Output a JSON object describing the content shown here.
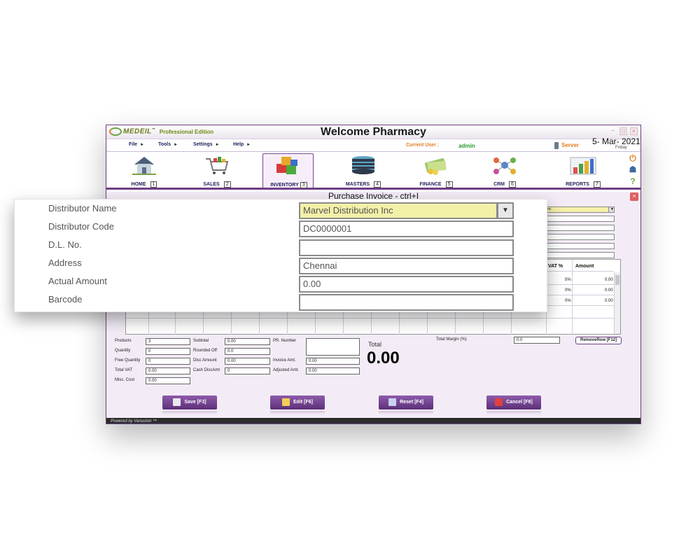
{
  "window": {
    "logo": "MEDEIL",
    "logo_tm": "™",
    "edition": "Professional Edition",
    "title": "Welcome Pharmacy",
    "close_glyph": "×"
  },
  "menu": {
    "items": [
      "File",
      "Tools",
      "Settings",
      "Help"
    ],
    "submenu_glyph": "►",
    "current_user_label": "Current User :",
    "current_user": "admin",
    "server_label": "Server",
    "date": "5- Mar- 2021",
    "day": "Friday"
  },
  "toolbar": {
    "items": [
      {
        "label": "HOME",
        "key": "1",
        "icon": "home-icon"
      },
      {
        "label": "SALES",
        "key": "2",
        "icon": "cart-icon"
      },
      {
        "label": "INVENTORY",
        "key": "3",
        "icon": "boxes-icon",
        "active": true
      },
      {
        "label": "MASTERS",
        "key": "4",
        "icon": "database-icon"
      },
      {
        "label": "FINANCE",
        "key": "5",
        "icon": "money-icon"
      },
      {
        "label": "CRM",
        "key": "6",
        "icon": "network-icon"
      },
      {
        "label": "REPORTS",
        "key": "7",
        "icon": "chart-icon"
      }
    ],
    "side_icons": [
      {
        "icon": "power-icon",
        "glyph": "⏻",
        "color": "#e07b1f"
      },
      {
        "icon": "user-icon",
        "glyph": "☗",
        "color": "#3a6aa0"
      },
      {
        "icon": "help-icon",
        "glyph": "?",
        "color": "#6aa63a"
      }
    ]
  },
  "form": {
    "title": "Purchase Invoice - ctrl+I",
    "distributor_short": "rn Inc",
    "grid": {
      "headers": [
        "VAT %",
        "Amount"
      ],
      "rows": [
        {
          "vat": "5%",
          "amount": "0.00"
        },
        {
          "vat": "0%",
          "amount": "0.00"
        },
        {
          "vat": "0%",
          "amount": "0.00"
        }
      ]
    },
    "summary": {
      "products_label": "Products",
      "products": "3",
      "quantity_label": "Quantity",
      "quantity": "0",
      "free_quantity_label": "Free Quantity",
      "free_quantity": "0",
      "total_vat_label": "Total VAT",
      "total_vat": "0.00",
      "misc_cost_label": "Misc. Cost",
      "misc_cost": "0.00",
      "subtotal_label": "Subtotal",
      "subtotal": "0.00",
      "rounded_off_label": "Rounded Off",
      "rounded_off": "0.0",
      "disc_amount_label": "Disc Amount",
      "disc_amount": "0.00",
      "cash_disc_label": "Cash DiscAmt",
      "cash_disc": "0",
      "pr_number_label": "PR. Number",
      "invoice_amt_label": "Invoice Amt.",
      "invoice_amt": "0.00",
      "adjusted_amt_label": "Adjusted Amt.",
      "adjusted_amt": "0.00",
      "total_margin_label": "Total Margin (%)",
      "total_margin": "0.0",
      "total_label": "Total",
      "total": "0.00",
      "remove_row": "RemoveRow [F12]"
    },
    "buttons": {
      "save": "Save  [F3]",
      "edit": "Edit [F6]",
      "reset": "Reset [F4]",
      "cancel": "Cancel [F8]"
    },
    "footer": "Powered by Vanuston ™"
  },
  "zoom": {
    "fields": [
      {
        "label": "Distributor Name",
        "value": "Marvel Distribution Inc"
      },
      {
        "label": "Distributor Code",
        "value": "DC0000001"
      },
      {
        "label": "D.L. No.",
        "value": ""
      },
      {
        "label": "Address",
        "value": "Chennai"
      },
      {
        "label": "Actual Amount",
        "value": "0.00"
      },
      {
        "label": "Barcode",
        "value": ""
      }
    ],
    "dropdown_glyph": "▼"
  },
  "colors": {
    "accent": "#6f3f86",
    "form_bg": "#f3ecf6",
    "selected_field": "#f3f0a8"
  }
}
